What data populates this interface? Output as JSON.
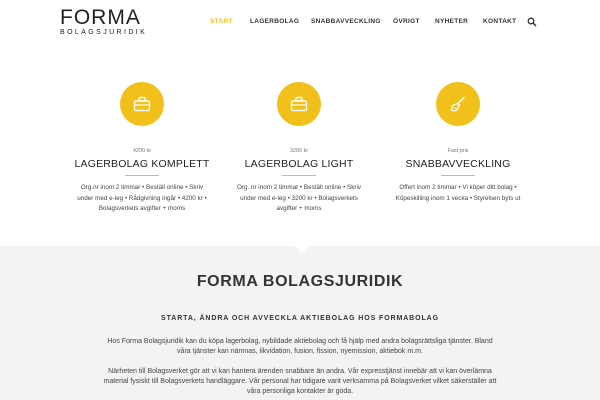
{
  "brand": {
    "name": "FORMA",
    "tagline": "BOLAGSJURIDIK"
  },
  "nav": {
    "items": [
      "START",
      "LAGERBOLAG",
      "SNABBAVVECKLING",
      "ÖVRIGT",
      "NYHETER",
      "KONTAKT"
    ],
    "active": "START",
    "search_icon": "search-icon"
  },
  "colors": {
    "accent": "#f2c01b",
    "section_bg": "#f3f3f3"
  },
  "services": [
    {
      "icon": "briefcase-icon",
      "price": "4200 kr",
      "title": "LAGERBOLAG KOMPLETT",
      "description": "Org.nr inom 2 timmar • Beställ online • Skriv under med e-leg • Rådgivning ingår • 4200 kr • Bolagsverkets avgifter + moms"
    },
    {
      "icon": "briefcase-icon",
      "price": "3200 kr",
      "title": "LAGERBOLAG LIGHT",
      "description": "Org. nr inom 2 timmar • Beställ online • Skriv under med e-leg • 3200 kr • Bolagsverkets avgifter + moms"
    },
    {
      "icon": "broom-icon",
      "price": "Fast pris",
      "title": "SNABBAVVECKLING",
      "description": "Offert inom 2 timmar • Vi köper ditt bolag • Köpeskilling inom 1 vecka • Styrelsen byts ut"
    }
  ],
  "about": {
    "title": "FORMA BOLAGSJURIDIK",
    "subtitle": "STARTA, ÄNDRA OCH AVVECKLA AKTIEBOLAG HOS FORMABOLAG",
    "paragraph1": "Hos Forma Bolagsjuridik kan du köpa lagerbolag, nybildade aktiebolag och få hjälp med andra bolagsrättsliga tjänster. Bland våra tjänster kan nämnas, likvidation, fusion, fission, nyemission, aktiebok m.m.",
    "paragraph2": "Närheten till Bolagsverket gör att vi kan hantera ärenden snabbare än andra. Vår expresstjänst innebär att vi kan överlämna material fysiskt till Bolagsverkets handläggare. Vår personal har tidigare varit verksamma på Bolagsverket vilket säkerställer att våra personliga kontakter är goda."
  }
}
